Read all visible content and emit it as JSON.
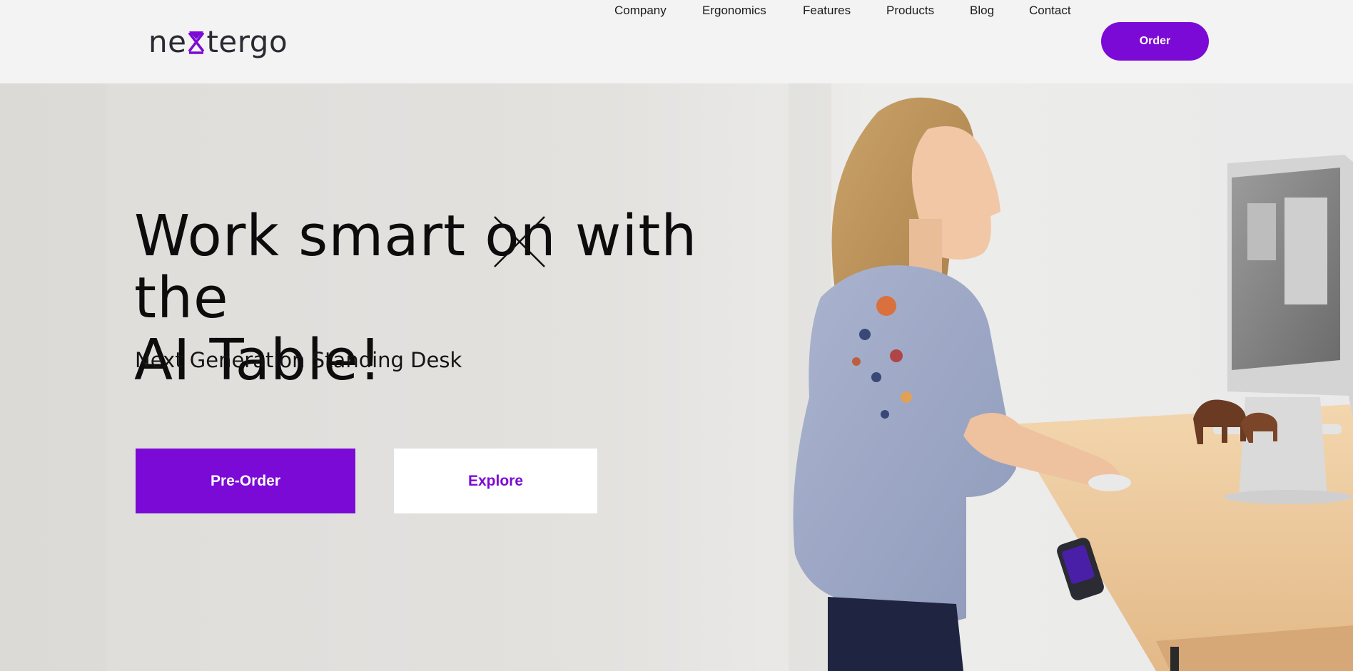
{
  "brand": {
    "logo_prefix": "ne",
    "logo_suffix": "tergo",
    "logo_alt": "nextergo",
    "accent_color": "#7c0ad6"
  },
  "nav": {
    "items": [
      {
        "label": "Company"
      },
      {
        "label": "Ergonomics"
      },
      {
        "label": "Features"
      },
      {
        "label": "Products"
      },
      {
        "label": "Blog"
      },
      {
        "label": "Contact"
      }
    ],
    "order_label": "Order"
  },
  "hero": {
    "headline_part1": "Work smart ",
    "headline_struck": "on",
    "headline_part2": " with the",
    "headline_line2": "AI Table!",
    "subheadline": "Next Generation Standing Desk",
    "preorder_label": "Pre-Order",
    "explore_label": "Explore",
    "image_subject": "woman-at-standing-desk-photo"
  }
}
